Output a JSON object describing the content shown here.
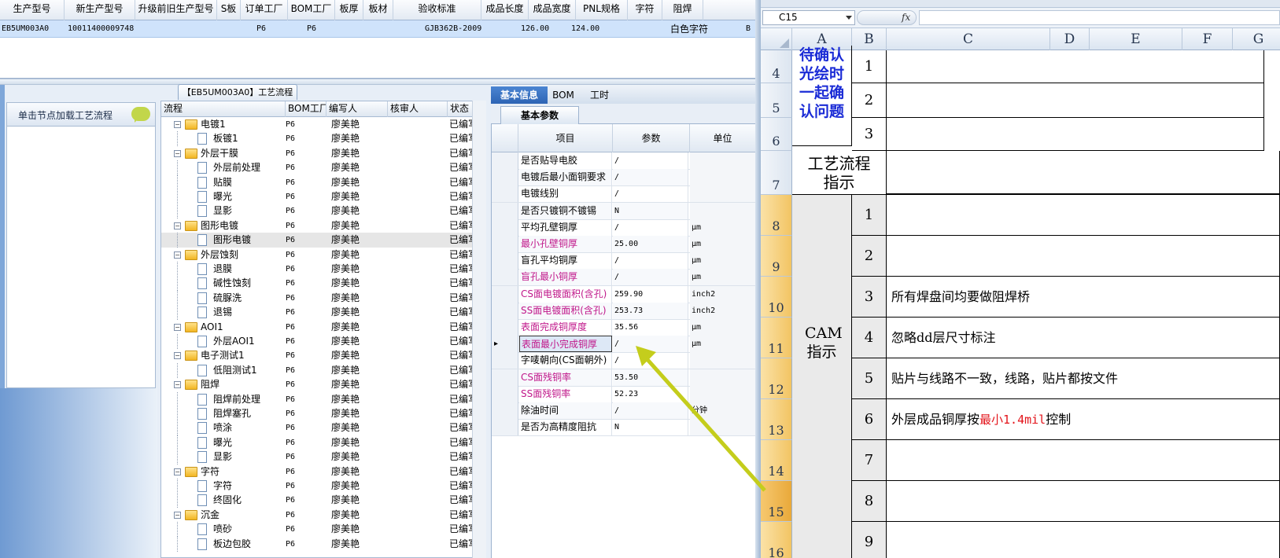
{
  "top_grid": {
    "headers": [
      "生产型号",
      "新生产型号",
      "升级前旧生产型号",
      "S板",
      "订单工厂",
      "BOM工厂",
      "板厚",
      "板材",
      "验收标准",
      "成品长度",
      "成品宽度",
      "PNL规格",
      "字符",
      "阻焊"
    ],
    "row": {
      "prod_model": "EB5UM003A0",
      "new_model": "10011400009748",
      "order_factory": "P6",
      "bom_factory": "P6",
      "standard": "GJB362B-2009",
      "length": "126.00",
      "width": "124.00",
      "char": "白色字符",
      "solder": "B"
    }
  },
  "flow_title": "【EB5UM003A0】工艺流程",
  "load_panel": {
    "label": "单击节点加载工艺流程"
  },
  "tree": {
    "headers": {
      "flow": "流程",
      "bom": "BOM工厂",
      "writer": "编写人",
      "auditor": "核审人",
      "status": "状态"
    },
    "rows": [
      {
        "label": "电镀1",
        "level": 0,
        "bom": "P6",
        "writer": "廖美艳",
        "status": "已编写"
      },
      {
        "label": "板镀1",
        "level": 1,
        "bom": "P6",
        "writer": "廖美艳",
        "status": "已编写"
      },
      {
        "label": "外层干膜",
        "level": 0,
        "bom": "P6",
        "writer": "廖美艳",
        "status": "已编写"
      },
      {
        "label": "外层前处理",
        "level": 1,
        "bom": "P6",
        "writer": "廖美艳",
        "status": "已编写"
      },
      {
        "label": "贴膜",
        "level": 1,
        "bom": "P6",
        "writer": "廖美艳",
        "status": "已编写"
      },
      {
        "label": "曝光",
        "level": 1,
        "bom": "P6",
        "writer": "廖美艳",
        "status": "已编写"
      },
      {
        "label": "显影",
        "level": 1,
        "bom": "P6",
        "writer": "廖美艳",
        "status": "已编写"
      },
      {
        "label": "图形电镀",
        "level": 0,
        "bom": "P6",
        "writer": "廖美艳",
        "status": "已编写"
      },
      {
        "label": "图形电镀",
        "level": 1,
        "bom": "P6",
        "writer": "廖美艳",
        "status": "已编写",
        "selected": true
      },
      {
        "label": "外层蚀刻",
        "level": 0,
        "bom": "P6",
        "writer": "廖美艳",
        "status": "已编写"
      },
      {
        "label": "退膜",
        "level": 1,
        "bom": "P6",
        "writer": "廖美艳",
        "status": "已编写"
      },
      {
        "label": "碱性蚀刻",
        "level": 1,
        "bom": "P6",
        "writer": "廖美艳",
        "status": "已编写"
      },
      {
        "label": "硫脲洗",
        "level": 1,
        "bom": "P6",
        "writer": "廖美艳",
        "status": "已编写"
      },
      {
        "label": "退锡",
        "level": 1,
        "bom": "P6",
        "writer": "廖美艳",
        "status": "已编写"
      },
      {
        "label": "AOI1",
        "level": 0,
        "bom": "P6",
        "writer": "廖美艳",
        "status": "已编写"
      },
      {
        "label": "外层AOI1",
        "level": 1,
        "bom": "P6",
        "writer": "廖美艳",
        "status": "已编写"
      },
      {
        "label": "电子测试1",
        "level": 0,
        "bom": "P6",
        "writer": "廖美艳",
        "status": "已编写"
      },
      {
        "label": "低阻测试1",
        "level": 1,
        "bom": "P6",
        "writer": "廖美艳",
        "status": "已编写"
      },
      {
        "label": "阻焊",
        "level": 0,
        "bom": "P6",
        "writer": "廖美艳",
        "status": "已编写"
      },
      {
        "label": "阻焊前处理",
        "level": 1,
        "bom": "P6",
        "writer": "廖美艳",
        "status": "已编写"
      },
      {
        "label": "阻焊塞孔",
        "level": 1,
        "bom": "P6",
        "writer": "廖美艳",
        "status": "已编写"
      },
      {
        "label": "喷涂",
        "level": 1,
        "bom": "P6",
        "writer": "廖美艳",
        "status": "已编写"
      },
      {
        "label": "曝光",
        "level": 1,
        "bom": "P6",
        "writer": "廖美艳",
        "status": "已编写"
      },
      {
        "label": "显影",
        "level": 1,
        "bom": "P6",
        "writer": "廖美艳",
        "status": "已编写"
      },
      {
        "label": "字符",
        "level": 0,
        "bom": "P6",
        "writer": "廖美艳",
        "status": "已编写"
      },
      {
        "label": "字符",
        "level": 1,
        "bom": "P6",
        "writer": "廖美艳",
        "status": "已编写"
      },
      {
        "label": "终固化",
        "level": 1,
        "bom": "P6",
        "writer": "廖美艳",
        "status": "已编写"
      },
      {
        "label": "沉金",
        "level": 0,
        "bom": "P6",
        "writer": "廖美艳",
        "status": "已编写"
      },
      {
        "label": "喷砂",
        "level": 1,
        "bom": "P6",
        "writer": "廖美艳",
        "status": "已编写"
      },
      {
        "label": "板边包胶",
        "level": 1,
        "bom": "P6",
        "writer": "廖美艳",
        "status": "已编写"
      }
    ]
  },
  "right_tabs": [
    "基本信息",
    "BOM",
    "工时"
  ],
  "sub_tab": "基本参数",
  "params": {
    "headers": {
      "item": "项目",
      "value": "参数",
      "unit": "单位"
    },
    "rows": [
      {
        "item": "是否贴导电胶",
        "value": "/",
        "unit": "",
        "pink": false
      },
      {
        "item": "电镀后最小面铜要求",
        "value": "/",
        "unit": "",
        "pink": false
      },
      {
        "item": "电镀线别",
        "value": "/",
        "unit": "",
        "pink": false
      },
      {
        "item": "是否只镀铜不镀锡",
        "value": "N",
        "unit": "",
        "pink": false
      },
      {
        "item": "平均孔壁铜厚",
        "value": "/",
        "unit": "μm",
        "pink": false
      },
      {
        "item": "最小孔壁铜厚",
        "value": "25.00",
        "unit": "μm",
        "pink": true
      },
      {
        "item": "盲孔平均铜厚",
        "value": "/",
        "unit": "μm",
        "pink": false
      },
      {
        "item": "盲孔最小铜厚",
        "value": "/",
        "unit": "μm",
        "pink": true
      },
      {
        "item": "CS面电镀面积(含孔)",
        "value": "259.90",
        "unit": "inch2",
        "pink": true
      },
      {
        "item": "SS面电镀面积(含孔)",
        "value": "253.73",
        "unit": "inch2",
        "pink": true
      },
      {
        "item": "表面完成铜厚度",
        "value": "35.56",
        "unit": "μm",
        "pink": true
      },
      {
        "item": "表面最小完成铜厚",
        "value": "/",
        "unit": "μm",
        "pink": true,
        "current": true
      },
      {
        "item": "字唛朝向(CS面朝外)",
        "value": "/",
        "unit": "",
        "pink": false
      },
      {
        "item": "CS面残铜率",
        "value": "53.50",
        "unit": "",
        "pink": true
      },
      {
        "item": "SS面残铜率",
        "value": "52.23",
        "unit": "",
        "pink": true
      },
      {
        "item": "除油时间",
        "value": "/",
        "unit": "分钟",
        "pink": false
      },
      {
        "item": "是否为高精度阻抗",
        "value": "N",
        "unit": "",
        "pink": false
      }
    ]
  },
  "excel": {
    "name_box": "C15",
    "fx": "fx",
    "columns": [
      "A",
      "B",
      "C",
      "D",
      "E",
      "F",
      "G"
    ],
    "row_numbers": [
      "4",
      "5",
      "6",
      "7",
      "8",
      "9",
      "10",
      "11",
      "12",
      "13",
      "14",
      "15",
      "16"
    ],
    "pending_label": "待确认光绘时一起确认问题",
    "pending_items": [
      "1",
      "2",
      "3"
    ],
    "flow_label": "工艺流程指示",
    "cam_label": "CAM指示",
    "cam_items": [
      {
        "num": "1",
        "text": ""
      },
      {
        "num": "2",
        "text": ""
      },
      {
        "num": "3",
        "text": "所有焊盘间均要做阻焊桥"
      },
      {
        "num": "4",
        "text": "忽略dd层尺寸标注"
      },
      {
        "num": "5",
        "text": "贴片与线路不一致，线路，贴片都按文件"
      },
      {
        "num": "6",
        "text": "外层成品铜厚按",
        "red": "最小1.4mil",
        "tail": "控制"
      },
      {
        "num": "7",
        "text": ""
      },
      {
        "num": "8",
        "text": ""
      },
      {
        "num": "9",
        "text": ""
      }
    ]
  },
  "colors": {
    "accent": "#2d64b4",
    "pink": "#c0178a",
    "red": "#e3141b",
    "blue_text": "#1a2bd6",
    "arrow": "#c4cd1c"
  }
}
